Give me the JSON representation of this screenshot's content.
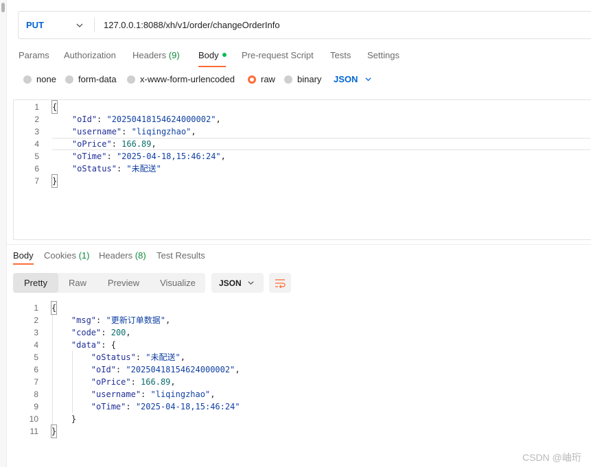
{
  "request": {
    "method": "PUT",
    "url": "127.0.0.1:8088/xh/v1/order/changeOrderInfo"
  },
  "request_tabs": [
    {
      "label": "Params",
      "count": ""
    },
    {
      "label": "Authorization",
      "count": ""
    },
    {
      "label": "Headers",
      "count": "(9)"
    },
    {
      "label": "Body",
      "count": ""
    },
    {
      "label": "Pre-request Script",
      "count": ""
    },
    {
      "label": "Tests",
      "count": ""
    },
    {
      "label": "Settings",
      "count": ""
    }
  ],
  "active_request_tab": "Body",
  "body_types": [
    "none",
    "form-data",
    "x-www-form-urlencoded",
    "raw",
    "binary"
  ],
  "selected_body_type": "raw",
  "raw_format": "JSON",
  "request_body": {
    "line_numbers": [
      "1",
      "2",
      "3",
      "4",
      "5",
      "6",
      "7"
    ],
    "open": "{",
    "close": "}",
    "fields": [
      {
        "key": "\"oId\"",
        "value": "\"20250418154624000002\"",
        "sep": ","
      },
      {
        "key": "\"username\"",
        "value": "\"liqingzhao\"",
        "sep": ","
      },
      {
        "key": "\"oPrice\"",
        "value": "166.89",
        "sep": ","
      },
      {
        "key": "\"oTime\"",
        "value": "\"2025-04-18,15:46:24\"",
        "sep": ","
      },
      {
        "key": "\"oStatus\"",
        "value": "\"未配送\"",
        "sep": ""
      }
    ]
  },
  "response_tabs": [
    {
      "label": "Body",
      "count": ""
    },
    {
      "label": "Cookies",
      "count": "(1)"
    },
    {
      "label": "Headers",
      "count": "(8)"
    },
    {
      "label": "Test Results",
      "count": ""
    }
  ],
  "view_modes": [
    "Pretty",
    "Raw",
    "Preview",
    "Visualize"
  ],
  "active_view_mode": "Pretty",
  "response_format": "JSON",
  "response_body": {
    "line_numbers": [
      "1",
      "2",
      "3",
      "4",
      "5",
      "6",
      "7",
      "8",
      "9",
      "10",
      "11"
    ],
    "open": "{",
    "close": "}",
    "inner_close": "}",
    "msg_key": "\"msg\"",
    "msg_value": "\"更新订单数据\"",
    "code_key": "\"code\"",
    "code_value": "200",
    "data_key": "\"data\"",
    "data_fields": [
      {
        "key": "\"oStatus\"",
        "value": "\"未配送\"",
        "sep": ","
      },
      {
        "key": "\"oId\"",
        "value": "\"20250418154624000002\"",
        "sep": ","
      },
      {
        "key": "\"oPrice\"",
        "value": "166.89",
        "sep": ","
      },
      {
        "key": "\"username\"",
        "value": "\"liqingzhao\"",
        "sep": ","
      },
      {
        "key": "\"oTime\"",
        "value": "\"2025-04-18,15:46:24\"",
        "sep": ""
      }
    ]
  },
  "watermark": "CSDN @岫珩",
  "colors": {
    "accent": "#ff6c37",
    "method": "#0265d2",
    "count": "#0f8a3c",
    "dot": "#0cbb52"
  },
  "icons": [
    "chevron-down-icon",
    "wrap-lines-icon"
  ]
}
